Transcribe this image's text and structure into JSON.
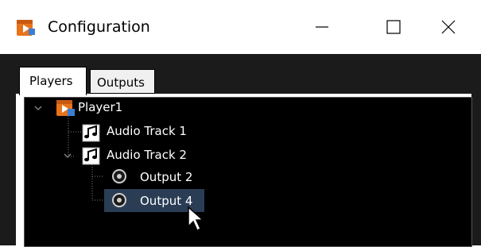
{
  "window": {
    "title": "Configuration",
    "icon": "orange-folder-play-icon",
    "controls": [
      "minimize-icon",
      "maximize-icon",
      "close-icon"
    ]
  },
  "tabs": [
    {
      "label": "Players",
      "active": true
    },
    {
      "label": "Outputs",
      "active": false
    }
  ],
  "tree": {
    "player": {
      "label": "Player1",
      "expanded": true
    },
    "tracks": [
      {
        "label": "Audio Track 1",
        "expanded": false
      },
      {
        "label": "Audio Track 2",
        "expanded": true,
        "outputs": [
          {
            "label": "Output 2",
            "selected": false
          },
          {
            "label": "Output 4",
            "selected": true
          }
        ]
      }
    ]
  },
  "colors": {
    "tree_background": "#000000",
    "selected": "#2a3d55",
    "text": "#ffffff",
    "app_icon": "#e8731a"
  }
}
